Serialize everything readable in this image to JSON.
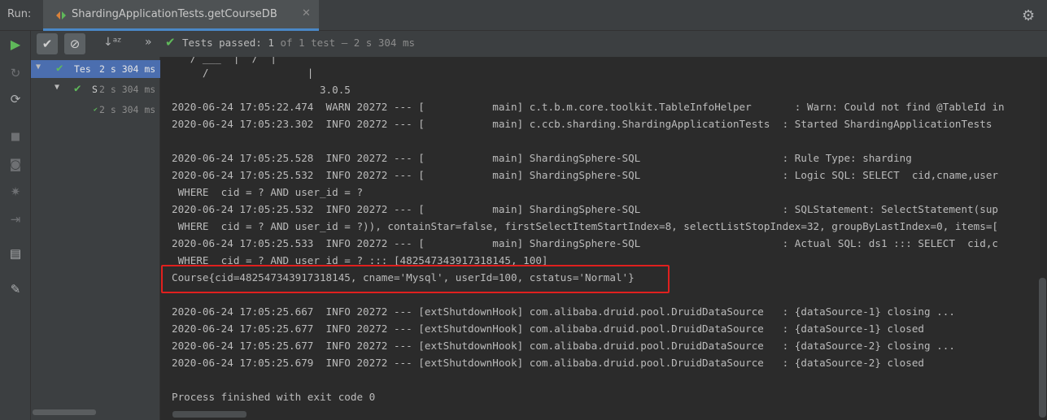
{
  "run_label": "Run:",
  "tab": {
    "title": "ShardingApplicationTests.getCourseDB",
    "close_glyph": "✕"
  },
  "settings_icon": "gear-icon",
  "test_toolbar": {
    "status": "Tests passed:",
    "passed_count": "1",
    "summary": "of 1 test – 2 s 304 ms"
  },
  "tree": [
    {
      "name": "Tes",
      "time": "2 s 304 ms",
      "selected": true
    },
    {
      "name": "S",
      "time": "2 s 304 ms",
      "selected": false
    },
    {
      "name": "",
      "time": "2 s 304 ms",
      "selected": false
    }
  ],
  "console_lines": [
    "   / ___  |  /  |",
    "     /                |",
    "                        3.0.5",
    "2020-06-24 17:05:22.474  WARN 20272 --- [           main] c.t.b.m.core.toolkit.TableInfoHelper       : Warn: Could not find @TableId in",
    "2020-06-24 17:05:23.302  INFO 20272 --- [           main] c.ccb.sharding.ShardingApplicationTests  : Started ShardingApplicationTests",
    "",
    "2020-06-24 17:05:25.528  INFO 20272 --- [           main] ShardingSphere-SQL                       : Rule Type: sharding",
    "2020-06-24 17:05:25.532  INFO 20272 --- [           main] ShardingSphere-SQL                       : Logic SQL: SELECT  cid,cname,user",
    " WHERE  cid = ? AND user_id = ?",
    "2020-06-24 17:05:25.532  INFO 20272 --- [           main] ShardingSphere-SQL                       : SQLStatement: SelectStatement(sup",
    " WHERE  cid = ? AND user_id = ?)), containStar=false, firstSelectItemStartIndex=8, selectListStopIndex=32, groupByLastIndex=0, items=[",
    "2020-06-24 17:05:25.533  INFO 20272 --- [           main] ShardingSphere-SQL                       : Actual SQL: ds1 ::: SELECT  cid,c",
    " WHERE  cid = ? AND user_id = ? ::: [482547343917318145, 100]",
    "Course{cid=482547343917318145, cname='Mysql', userId=100, cstatus='Normal'}",
    "",
    "2020-06-24 17:05:25.667  INFO 20272 --- [extShutdownHook] com.alibaba.druid.pool.DruidDataSource   : {dataSource-1} closing ...",
    "2020-06-24 17:05:25.677  INFO 20272 --- [extShutdownHook] com.alibaba.druid.pool.DruidDataSource   : {dataSource-1} closed",
    "2020-06-24 17:05:25.677  INFO 20272 --- [extShutdownHook] com.alibaba.druid.pool.DruidDataSource   : {dataSource-2} closing ...",
    "2020-06-24 17:05:25.679  INFO 20272 --- [extShutdownHook] com.alibaba.druid.pool.DruidDataSource   : {dataSource-2} closed",
    "",
    "Process finished with exit code 0"
  ],
  "colors": {
    "pass_green": "#5fb95a",
    "highlight_red": "#e0201e",
    "selection_blue": "#4b6eaf"
  }
}
